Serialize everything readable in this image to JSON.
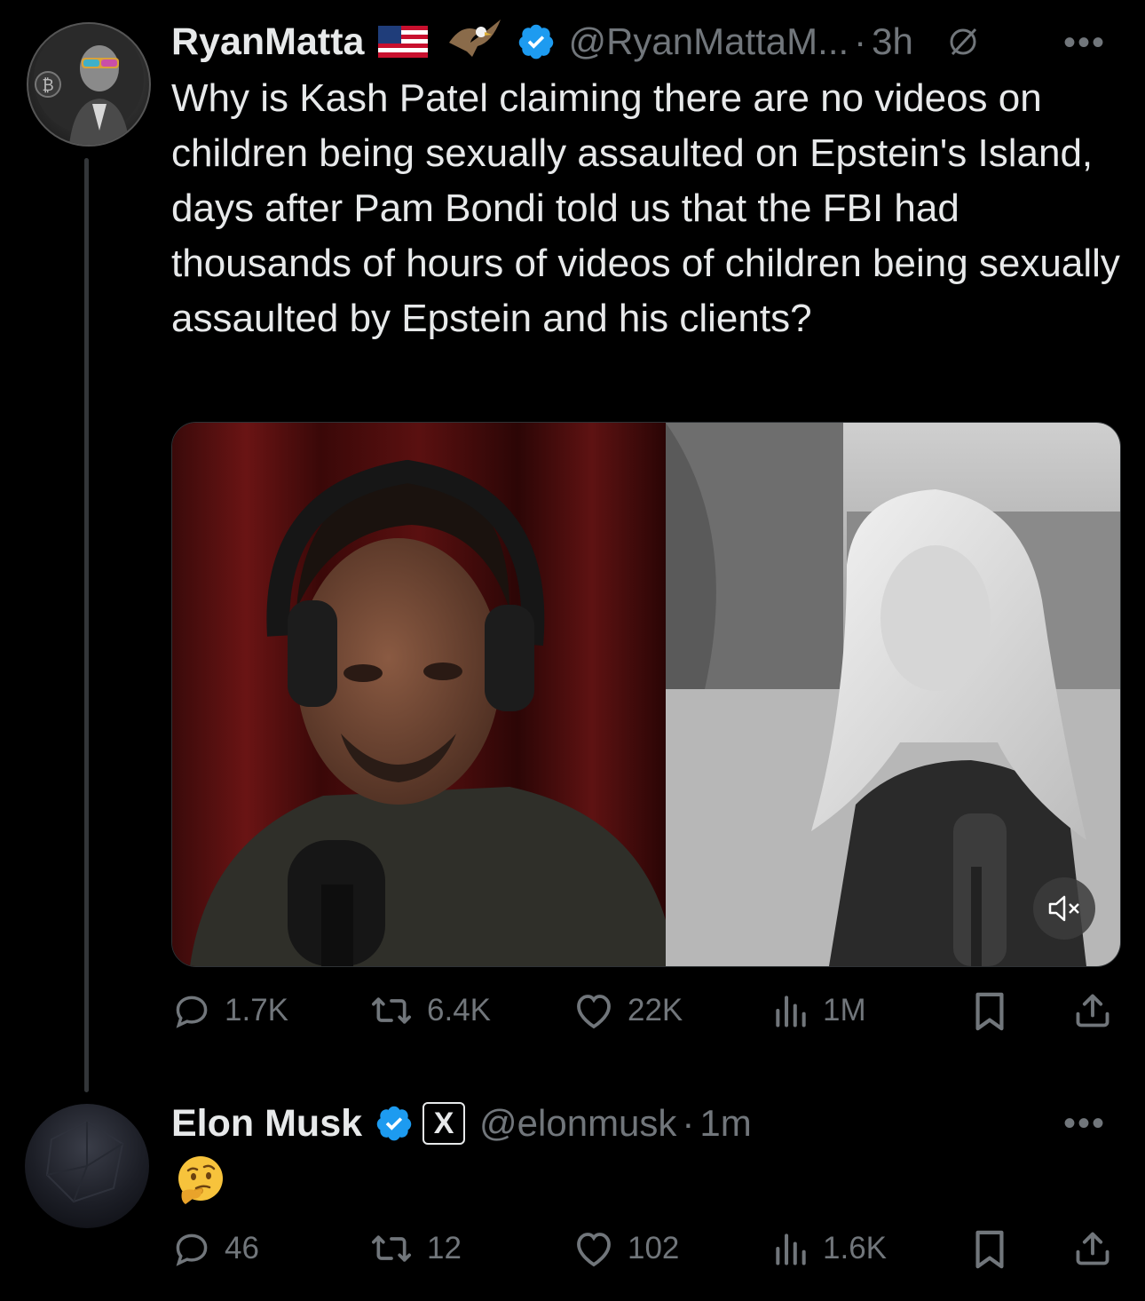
{
  "tweet1": {
    "name": "RyanMatta",
    "handle": "@RyanMattaM...",
    "time": "3h",
    "text": "Why is Kash Patel claiming there are no videos on children being sexually assaulted on Epstein's Island, days after Pam Bondi told us that the FBI had thousands of hours of videos of children being sexually assaulted by Epstein and his clients?",
    "actions": {
      "replies": "1.7K",
      "reposts": "6.4K",
      "likes": "22K",
      "views": "1M"
    }
  },
  "tweet2": {
    "name": "Elon Musk",
    "badge": "X",
    "handle": "@elonmusk",
    "time": "1m",
    "text": "🤔",
    "actions": {
      "replies": "46",
      "reposts": "12",
      "likes": "102",
      "views": "1.6K"
    }
  },
  "colors": {
    "background": "#000000",
    "text": "#e7e9ea",
    "muted": "#71767b",
    "verified": "#1d9bf0",
    "thread_line": "#333639"
  },
  "icons": [
    "reply-icon",
    "repost-icon",
    "like-icon",
    "views-icon",
    "bookmark-icon",
    "share-icon",
    "verified-icon",
    "flag-icon",
    "eagle-icon",
    "mute-icon"
  ]
}
